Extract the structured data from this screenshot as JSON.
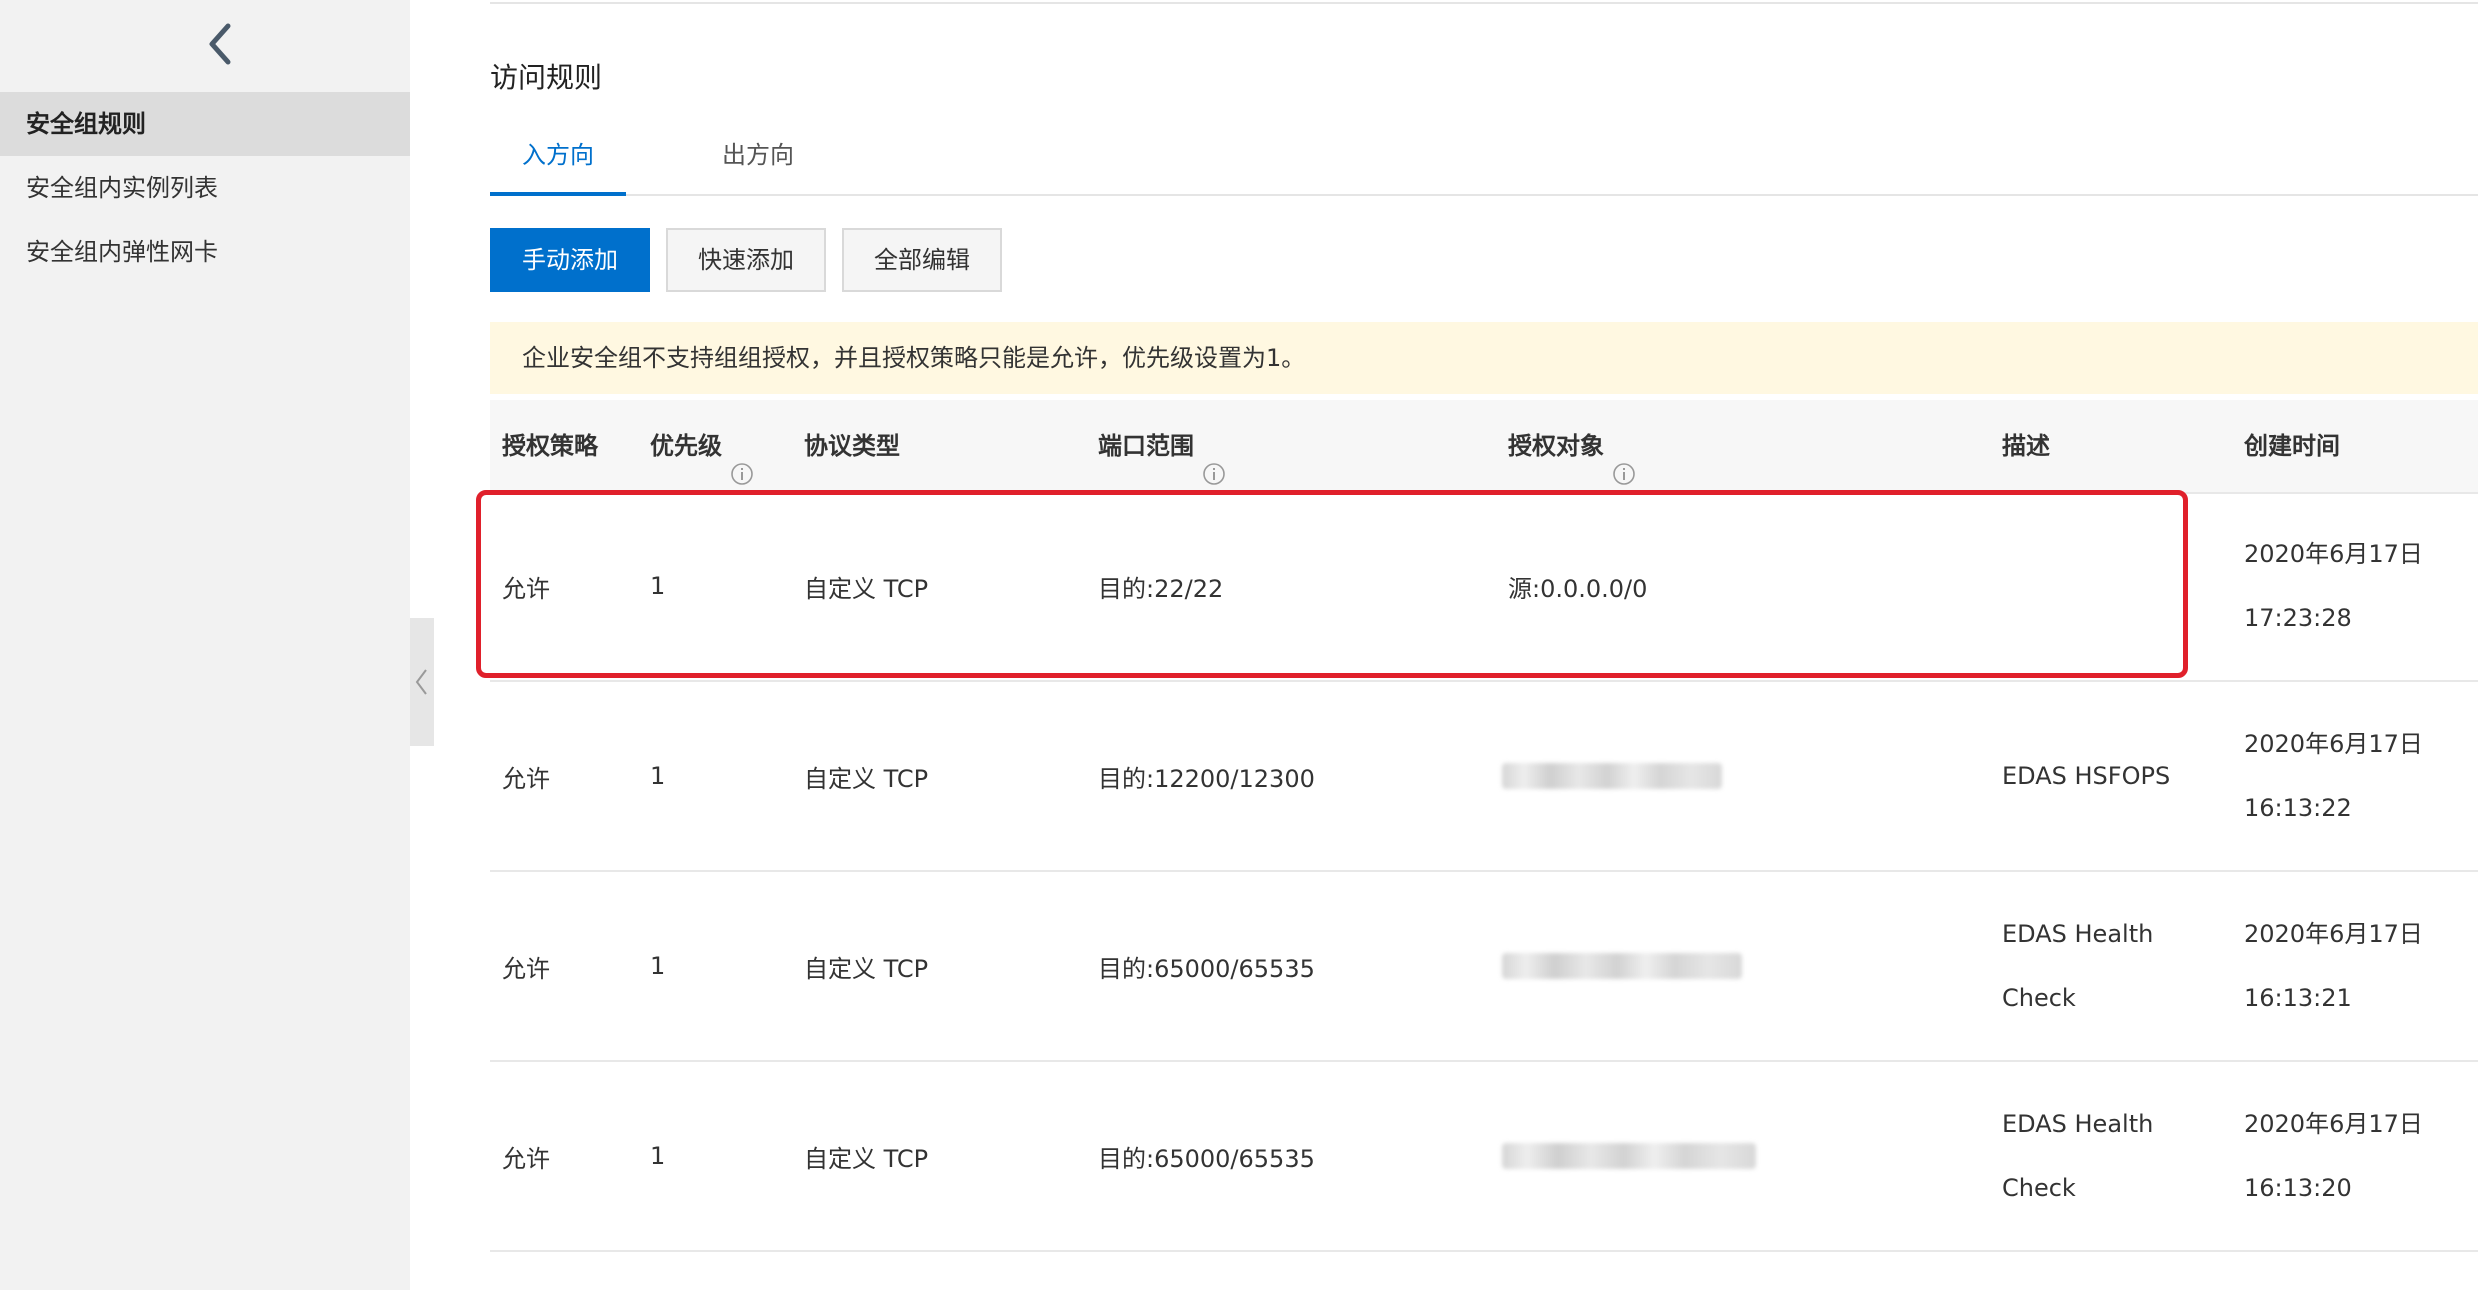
{
  "sidebar": {
    "items": [
      {
        "label": "安全组规则",
        "active": true
      },
      {
        "label": "安全组内实例列表",
        "active": false
      },
      {
        "label": "安全组内弹性网卡",
        "active": false
      }
    ]
  },
  "main": {
    "title": "访问规则",
    "tabs": [
      {
        "label": "入方向",
        "active": true
      },
      {
        "label": "出方向",
        "active": false
      }
    ],
    "toolbar": {
      "manual_add": "手动添加",
      "quick_add": "快速添加",
      "edit_all": "全部编辑"
    },
    "notice": "企业安全组不支持组组授权，并且授权策略只能是允许，优先级设置为1。",
    "table": {
      "headers": {
        "policy": "授权策略",
        "priority": "优先级",
        "protocol": "协议类型",
        "port": "端口范围",
        "object": "授权对象",
        "desc": "描述",
        "created": "创建时间"
      },
      "rows": [
        {
          "policy": "允许",
          "priority": "1",
          "protocol": "自定义 TCP",
          "port": "目的:22/22",
          "object": "源:0.0.0.0/0",
          "object_redacted": false,
          "desc_line1": "",
          "desc_line2": "",
          "date": "2020年6月17日",
          "time": "17:23:28"
        },
        {
          "policy": "允许",
          "priority": "1",
          "protocol": "自定义 TCP",
          "port": "目的:12200/12300",
          "object": "",
          "object_redacted": true,
          "desc_line1": "EDAS HSFOPS",
          "desc_line2": "",
          "date": "2020年6月17日",
          "time": "16:13:22"
        },
        {
          "policy": "允许",
          "priority": "1",
          "protocol": "自定义 TCP",
          "port": "目的:65000/65535",
          "object": "",
          "object_redacted": true,
          "desc_line1": "EDAS Health",
          "desc_line2": "Check",
          "date": "2020年6月17日",
          "time": "16:13:21"
        },
        {
          "policy": "允许",
          "priority": "1",
          "protocol": "自定义 TCP",
          "port": "目的:65000/65535",
          "object": "",
          "object_redacted": true,
          "desc_line1": "EDAS Health",
          "desc_line2": "Check",
          "date": "2020年6月17日",
          "time": "16:13:20"
        }
      ]
    }
  },
  "colors": {
    "primary": "#0070cc",
    "notice_bg": "#fff8e1",
    "highlight": "#e0202b",
    "sidebar_bg": "#f2f2f2"
  },
  "icons": {
    "back": "chevron-left-icon",
    "collapse": "chevron-left-icon",
    "info": "info-icon"
  }
}
